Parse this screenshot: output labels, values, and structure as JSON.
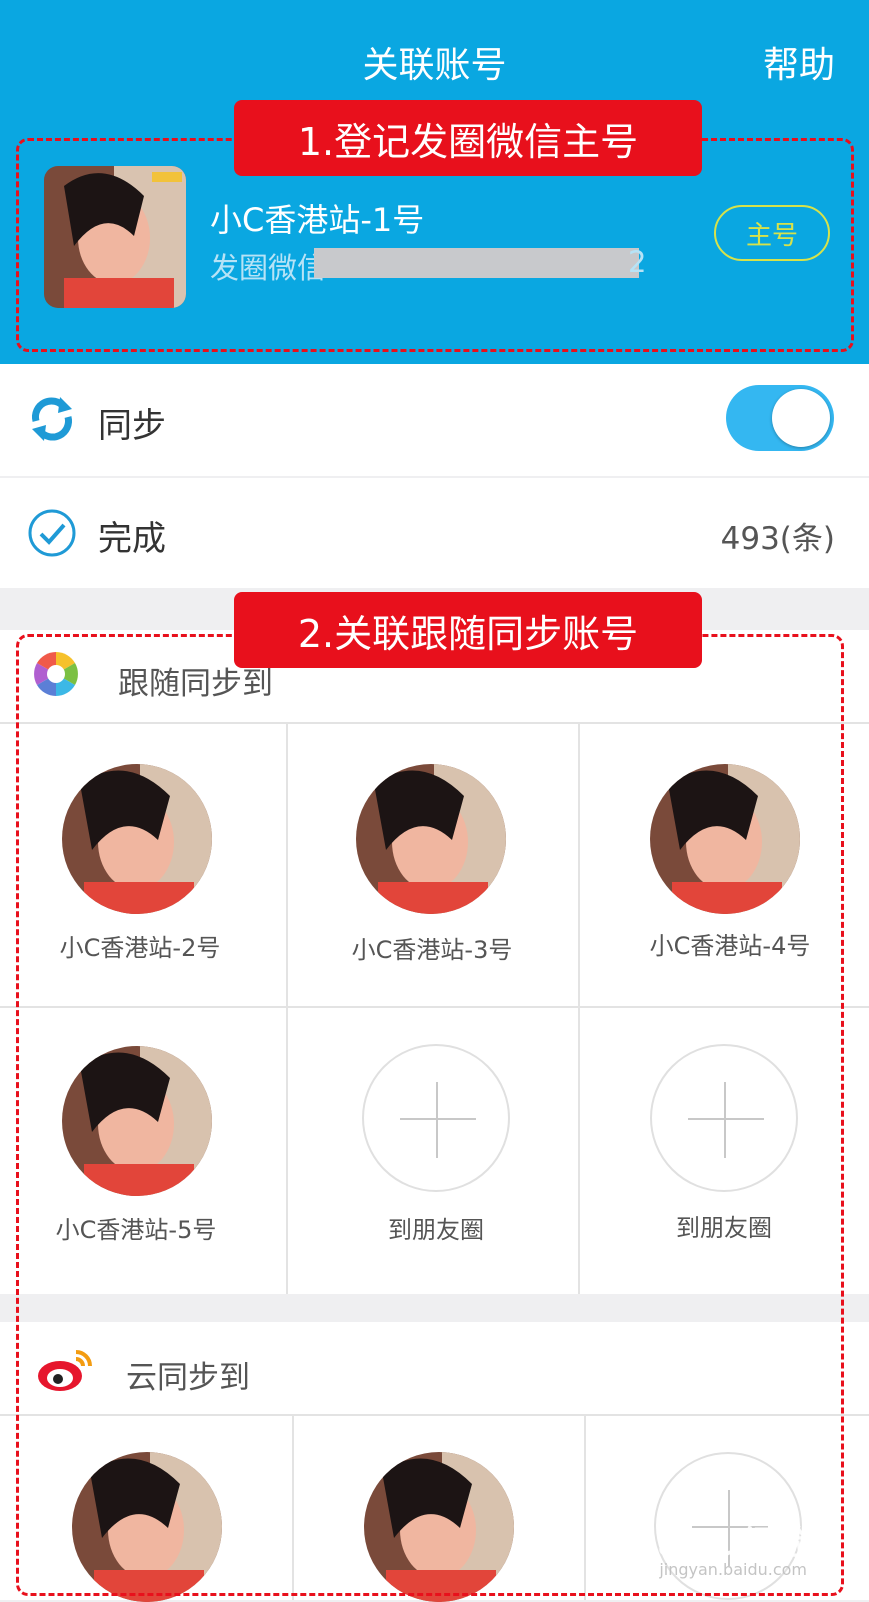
{
  "header": {
    "title": "关联账号",
    "help_label": "帮助"
  },
  "annotations": {
    "step1": "1.登记发圈微信主号",
    "step2": "2.关联跟随同步账号"
  },
  "main_account": {
    "name": "小C香港站-1号",
    "subtitle_visible": "发圈微信",
    "subtitle_tail": "2",
    "badge": "主号"
  },
  "settings": {
    "sync_label": "同步",
    "sync_enabled": true,
    "done_label": "完成",
    "done_count": "493(条)"
  },
  "follow_section": {
    "title": "跟随同步到",
    "items": [
      {
        "label": "小C香港站-2号",
        "type": "account"
      },
      {
        "label": "小C香港站-3号",
        "type": "account"
      },
      {
        "label": "小C香港站-4号",
        "type": "account"
      },
      {
        "label": "小C香港站-5号",
        "type": "account"
      },
      {
        "label": "到朋友圈",
        "type": "add"
      },
      {
        "label": "到朋友圈",
        "type": "add"
      }
    ]
  },
  "cloud_section": {
    "title": "云同步到",
    "items": [
      {
        "type": "account"
      },
      {
        "type": "account"
      },
      {
        "type": "add"
      }
    ]
  },
  "watermark": {
    "text": "Baidu经验",
    "sub": "jingyan.baidu.com"
  },
  "colors": {
    "header_blue": "#0aa7e1",
    "annotation_red": "#e8101c",
    "toggle_blue": "#34b7f1",
    "badge_yellow": "#d7e24a"
  }
}
